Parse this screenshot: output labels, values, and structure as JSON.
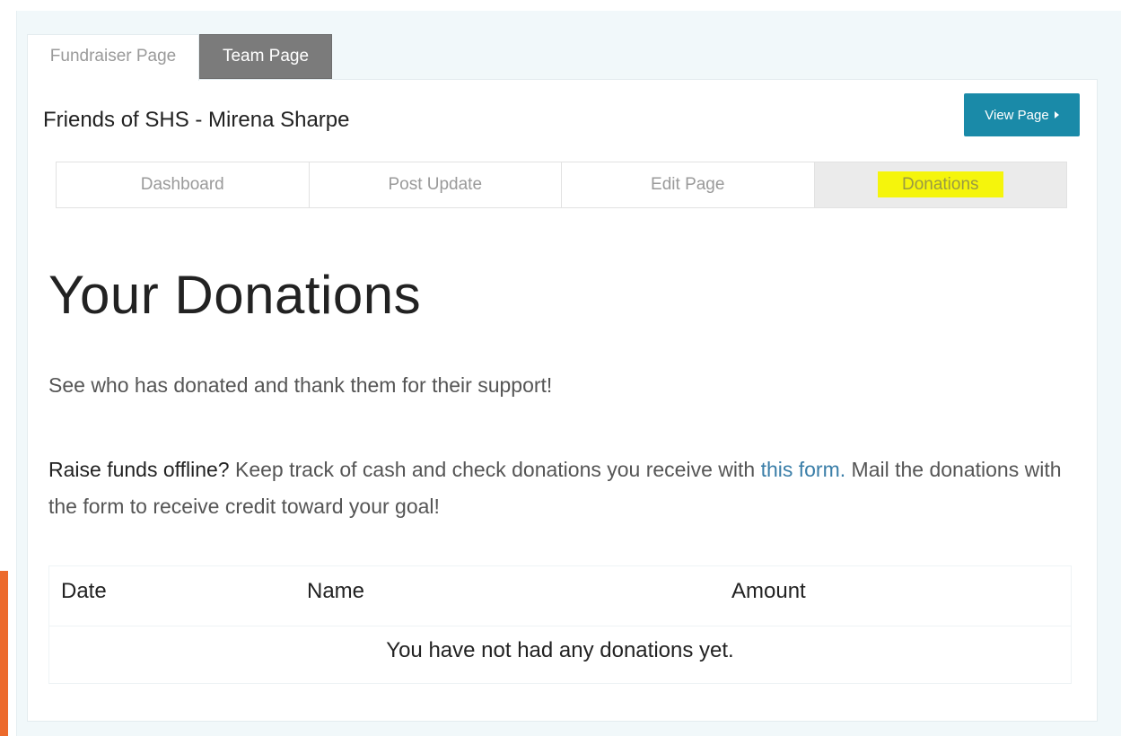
{
  "tabs": {
    "fundraiser_label": "Fundraiser Page",
    "team_label": "Team Page"
  },
  "header": {
    "page_name": "Friends of SHS - Mirena Sharpe",
    "view_button_label": "View Page"
  },
  "subnav": {
    "items": [
      {
        "label": "Dashboard"
      },
      {
        "label": "Post Update"
      },
      {
        "label": "Edit Page"
      },
      {
        "label": "Donations"
      }
    ],
    "active": "Donations",
    "highlight_color": "#f5f50c"
  },
  "content": {
    "heading": "Your Donations",
    "intro": "See who has donated and thank them for their support!",
    "offline_strong": "Raise funds offline?",
    "offline_text_1": " Keep track of cash and check donations you receive with ",
    "offline_link": "this form.",
    "offline_text_2": " Mail the donations with the form to receive credit toward your goal!"
  },
  "table": {
    "columns": [
      "Date",
      "Name",
      "Amount"
    ],
    "empty_message": "You have not had any donations yet."
  },
  "colors": {
    "accent": "#1a8aa8",
    "link": "#3a7ea8",
    "team_tab": "#7b7b7b",
    "edge_bar": "#ec6a2c",
    "background": "#f1f8fa"
  },
  "icons": {
    "view_button_icon": "caret-right-icon"
  }
}
